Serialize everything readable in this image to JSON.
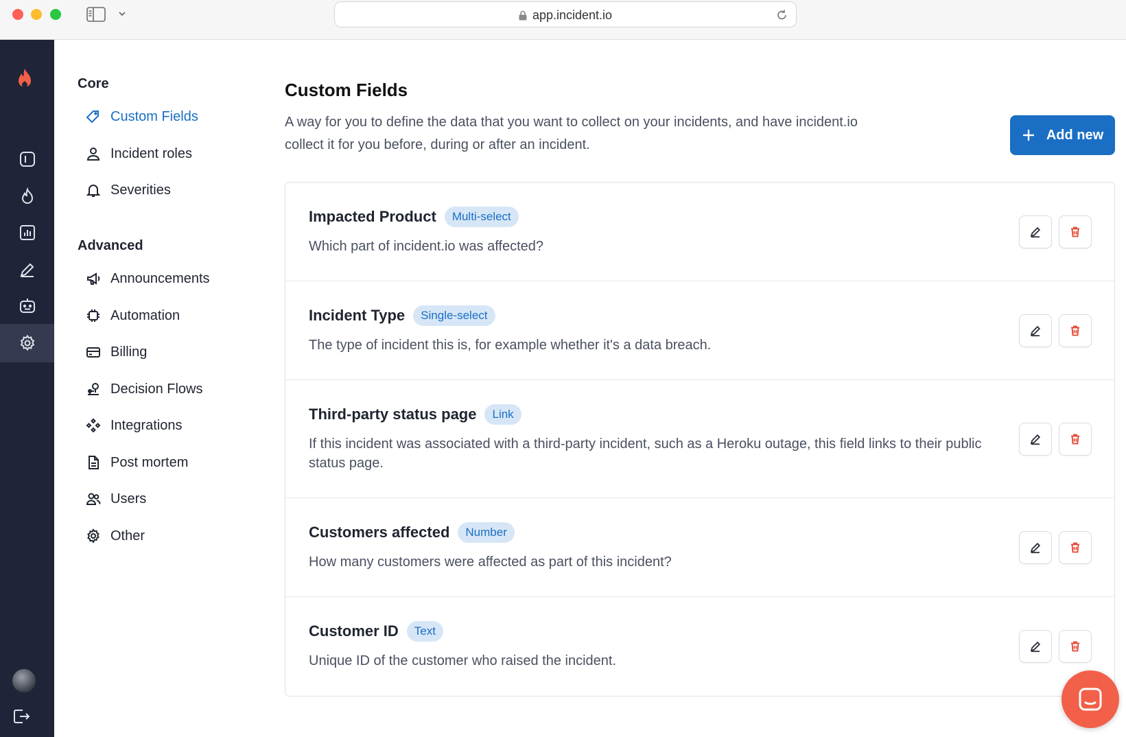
{
  "browser": {
    "url": "app.incident.io"
  },
  "nav": {
    "core_heading": "Core",
    "core_items": [
      {
        "label": "Custom Fields",
        "icon": "tag-icon",
        "active": true
      },
      {
        "label": "Incident roles",
        "icon": "user-icon"
      },
      {
        "label": "Severities",
        "icon": "bell-icon"
      }
    ],
    "advanced_heading": "Advanced",
    "advanced_items": [
      {
        "label": "Announcements",
        "icon": "megaphone-icon"
      },
      {
        "label": "Automation",
        "icon": "chip-icon"
      },
      {
        "label": "Billing",
        "icon": "credit-card-icon"
      },
      {
        "label": "Decision Flows",
        "icon": "decision-flow-icon"
      },
      {
        "label": "Integrations",
        "icon": "integrations-icon"
      },
      {
        "label": "Post mortem",
        "icon": "document-icon"
      },
      {
        "label": "Users",
        "icon": "users-icon"
      },
      {
        "label": "Other",
        "icon": "cog-icon"
      }
    ]
  },
  "main": {
    "title": "Custom Fields",
    "description": "A way for you to define the data that you want to collect on your incidents, and have incident.io collect it for you before, during or after an incident.",
    "add_button": "Add new",
    "fields": [
      {
        "name": "Impacted Product",
        "type": "Multi-select",
        "description": "Which part of incident.io was affected?"
      },
      {
        "name": "Incident Type",
        "type": "Single-select",
        "description": "The type of incident this is, for example whether it's a data breach."
      },
      {
        "name": "Third-party status page",
        "type": "Link",
        "description": "If this incident was associated with a third-party incident, such as a Heroku outage, this field links to their public status page."
      },
      {
        "name": "Customers affected",
        "type": "Number",
        "description": "How many customers were affected as part of this incident?"
      },
      {
        "name": "Customer ID",
        "type": "Text",
        "description": "Unique ID of the customer who raised the incident."
      }
    ]
  },
  "colors": {
    "accent": "#1a6fc4",
    "rail": "#1f2438",
    "danger": "#e5432e",
    "brand": "#f2604a"
  }
}
